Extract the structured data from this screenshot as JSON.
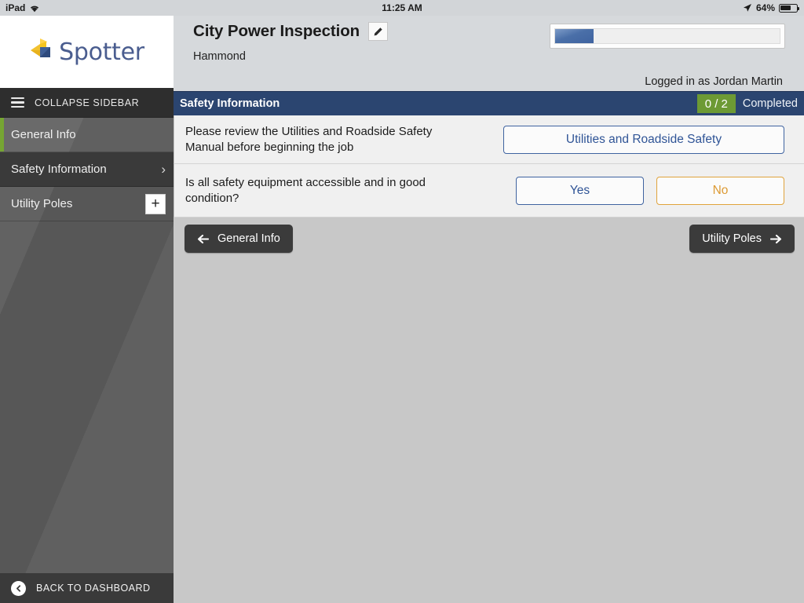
{
  "statusbar": {
    "device": "iPad",
    "wifi_icon": "wifi-icon",
    "time": "11:25 AM",
    "location_icon": "location-arrow-icon",
    "battery_percent": "64%",
    "battery_icon": "battery-icon"
  },
  "sidebar": {
    "logo_text": "Spotter",
    "logo_icon": "spotter-logo-icon",
    "collapse_label": "COLLAPSE SIDEBAR",
    "menu_icon": "hamburger-icon",
    "items": [
      {
        "label": "General Info",
        "state": "visited",
        "accent": "#76a533"
      },
      {
        "label": "Safety Information",
        "state": "active",
        "chevron": "›"
      },
      {
        "label": "Utility Poles",
        "state": "default",
        "add_label": "+"
      }
    ],
    "back_to_dashboard": "BACK TO DASHBOARD",
    "back_icon": "circle-back-arrow-icon"
  },
  "header": {
    "title": "City Power Inspection",
    "edit_icon": "pencil-icon",
    "subtitle": "Hammond",
    "progress_percent": 17,
    "logged_in": "Logged in as Jordan Martin"
  },
  "section": {
    "title": "Safety Information",
    "count": "0 / 2",
    "completed_label": "Completed",
    "bar_color": "#2b4570",
    "badge_color": "#6d9a34"
  },
  "questions": [
    {
      "text": "Please review the Utilities and Roadside Safety Manual before beginning the job",
      "buttons": [
        {
          "label": "Utilities and Roadside Safety",
          "style": "blue",
          "name": "utilities-roadside-safety-button"
        }
      ]
    },
    {
      "text": "Is all safety equipment accessible and in good condition?",
      "buttons": [
        {
          "label": "Yes",
          "style": "blue",
          "name": "answer-yes-button"
        },
        {
          "label": "No",
          "style": "orange",
          "name": "answer-no-button"
        }
      ]
    }
  ],
  "footer_nav": {
    "prev_label": "General Info",
    "prev_icon": "arrow-left-icon",
    "next_label": "Utility Poles",
    "next_icon": "arrow-right-icon"
  }
}
